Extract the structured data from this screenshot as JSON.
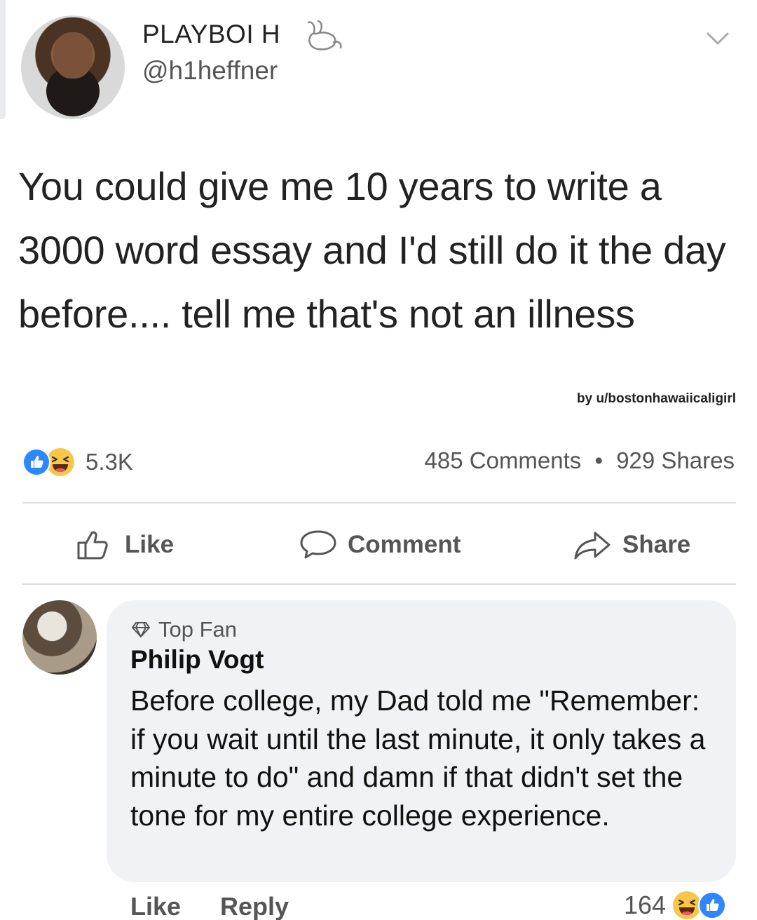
{
  "tweet": {
    "display_name": "PLAYBOI H",
    "handle": "@h1heffner",
    "text": "You could give me 10 years to write a 3000 word essay and I'd still do it the day before.... tell me that's not an illness",
    "credit": "by u/bostonhawaiicaligirl"
  },
  "post_stats": {
    "reaction_count": "5.3K",
    "comments": "485 Comments",
    "shares": "929 Shares",
    "separator": "•"
  },
  "actions": {
    "like": "Like",
    "comment": "Comment",
    "share": "Share"
  },
  "comment": {
    "badge": "Top Fan",
    "author": "Philip Vogt",
    "text": "Before college, my Dad told me \"Remember: if you wait until the last minute, it only takes a minute to do\" and damn if that didn't set the tone for my entire college experience.",
    "like_label": "Like",
    "reply_label": "Reply",
    "reaction_count": "164"
  },
  "icons": {
    "reaction_like": "like-reaction-icon",
    "reaction_haha": "haha-reaction-icon",
    "thumbs_up": "thumbs-up-icon",
    "speech_bubble": "comment-icon",
    "share_arrow": "share-icon",
    "diamond": "diamond-icon",
    "chevron": "chevron-down-icon",
    "bunny": "bunny-icon"
  },
  "colors": {
    "like_blue": "#2d88ff",
    "haha_yellow": "#f7c64a",
    "bubble_bg": "#f0f2f5",
    "muted_text": "#555555"
  }
}
